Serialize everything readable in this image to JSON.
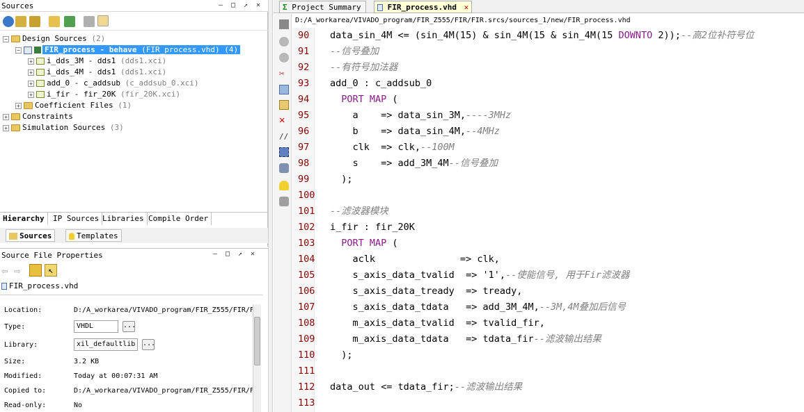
{
  "sources_panel": {
    "title": "Sources",
    "tree": [
      {
        "label": "Design Sources",
        "suffix": "(2)"
      },
      {
        "label": "FIR_process - behave",
        "suffix": "(FIR_process.vhd) (4)"
      },
      {
        "label": "i_dds_3M - dds1",
        "suffix": "(dds1.xci)"
      },
      {
        "label": "i_dds_4M - dds1",
        "suffix": "(dds1.xci)"
      },
      {
        "label": "add_0 - c_addsub",
        "suffix": "(c_addsub_0.xci)"
      },
      {
        "label": "i_fir - fir_20K",
        "suffix": "(fir_20K.xci)"
      },
      {
        "label": "Coefficient Files",
        "suffix": "(1)"
      },
      {
        "label": "Constraints",
        "suffix": ""
      },
      {
        "label": "Simulation Sources",
        "suffix": "(3)"
      }
    ],
    "tabs": [
      "Hierarchy",
      "IP Sources",
      "Libraries",
      "Compile Order"
    ],
    "bottom_tabs": [
      "Sources",
      "Templates"
    ]
  },
  "properties_panel": {
    "title": "Source File Properties",
    "file_name": "FIR_process.vhd",
    "rows": [
      {
        "label": "Location:",
        "value": "D:/A_workarea/VIVADO_program/FIR_Z555/FIR/F"
      },
      {
        "label": "Type:",
        "value": "VHDL"
      },
      {
        "label": "Library:",
        "value": "xil_defaultlib"
      },
      {
        "label": "Size:",
        "value": "3.2 KB"
      },
      {
        "label": "Modified:",
        "value": "Today at 00:07:31 AM"
      },
      {
        "label": "Copied to:",
        "value": "D:/A_workarea/VIVADO_program/FIR_Z555/FIR/F"
      },
      {
        "label": "Read-only:",
        "value": "No"
      }
    ],
    "dots": "..."
  },
  "editor": {
    "tabs": [
      {
        "label": "Project Summary"
      },
      {
        "label": "FIR_process.vhd"
      }
    ],
    "path": "D:/A_workarea/VIVADO_program/FIR_Z555/FIR/FIR.srcs/sources_1/new/FIR_process.vhd",
    "lines": [
      {
        "num": "90",
        "code": "data_sin_4M <= (sin_4M(15) & sin_4M(15 & sin_4M(15 ",
        "kw": "DOWNTO",
        "after": " 2));",
        "comment": "--高2位补符号位"
      },
      {
        "num": "91",
        "code": "",
        "comment": "--信号叠加"
      },
      {
        "num": "92",
        "code": "",
        "comment": "--有符号加法器"
      },
      {
        "num": "93",
        "code": "add_0 : c_addsub_0",
        "comment": ""
      },
      {
        "num": "94",
        "code": "  ",
        "kw": "PORT MAP",
        "after": " (",
        "comment": ""
      },
      {
        "num": "95",
        "code": "    a    => data_sin_3M,",
        "comment": "----3MHz"
      },
      {
        "num": "96",
        "code": "    b    => data_sin_4M,",
        "comment": "--4MHz"
      },
      {
        "num": "97",
        "code": "    clk  => clk,",
        "comment": "--100M"
      },
      {
        "num": "98",
        "code": "    s    => add_3M_4M",
        "comment": "--信号叠加"
      },
      {
        "num": "99",
        "code": "  );",
        "comment": ""
      },
      {
        "num": "100",
        "code": "",
        "comment": ""
      },
      {
        "num": "101",
        "code": "",
        "comment": "--滤波器模块"
      },
      {
        "num": "102",
        "code": "i_fir : fir_20K",
        "comment": ""
      },
      {
        "num": "103",
        "code": "  ",
        "kw": "PORT MAP",
        "after": " (",
        "comment": ""
      },
      {
        "num": "104",
        "code": "    aclk               => clk,",
        "comment": ""
      },
      {
        "num": "105",
        "code": "    s_axis_data_tvalid  => '1',",
        "comment": "--使能信号, 用于Fir滤波器"
      },
      {
        "num": "106",
        "code": "    s_axis_data_tready  => tready,",
        "comment": ""
      },
      {
        "num": "107",
        "code": "    s_axis_data_tdata   => add_3M_4M,",
        "comment": "--3M,4M叠加后信号"
      },
      {
        "num": "108",
        "code": "    m_axis_data_tvalid  => tvalid_fir,",
        "comment": ""
      },
      {
        "num": "109",
        "code": "    m_axis_data_tdata   => tdata_fir",
        "comment": "--滤波输出结果"
      },
      {
        "num": "110",
        "code": "  );",
        "comment": ""
      },
      {
        "num": "111",
        "code": "",
        "comment": ""
      },
      {
        "num": "112",
        "code": "data_out <= tdata_fir;",
        "comment": "--滤波输出结果"
      },
      {
        "num": "113",
        "code": "",
        "comment": ""
      }
    ]
  }
}
